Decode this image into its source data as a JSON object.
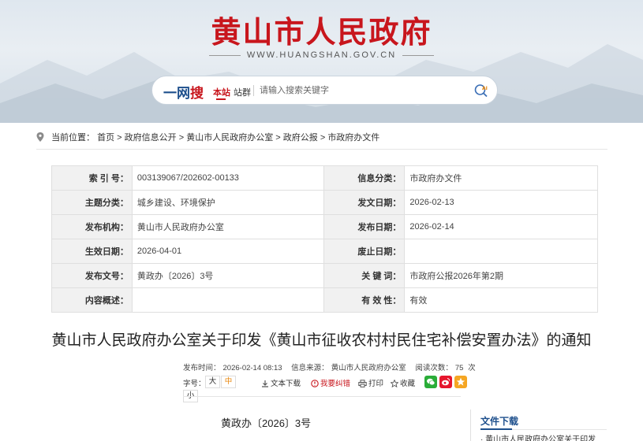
{
  "header": {
    "site_title": "黄山市人民政府",
    "site_url": "WWW.HUANGSHAN.GOV.CN",
    "search": {
      "brand_prefix": "一网",
      "brand_suffix": "搜",
      "scope_site": "本站",
      "scope_group": "站群",
      "placeholder": "请输入搜索关键字"
    }
  },
  "breadcrumb": {
    "prefix": "当前位置：",
    "items": [
      "首页",
      "政府信息公开",
      "黄山市人民政府办公室",
      "政府公报",
      "市政府办文件"
    ],
    "separator": " > "
  },
  "info_table": {
    "rows": [
      {
        "l1": "索 引 号：",
        "v1": "003139067/202602-00133",
        "l2": "信息分类：",
        "v2": "市政府办文件"
      },
      {
        "l1": "主题分类：",
        "v1": "城乡建设、环境保护",
        "l2": "发文日期：",
        "v2": "2026-02-13"
      },
      {
        "l1": "发布机构：",
        "v1": "黄山市人民政府办公室",
        "l2": "发布日期：",
        "v2": "2026-02-14"
      },
      {
        "l1": "生效日期：",
        "v1": "2026-04-01",
        "l2": "废止日期：",
        "v2": ""
      },
      {
        "l1": "发布文号：",
        "v1": "黄政办〔2026〕3号",
        "l2": "关 键 词：",
        "v2": "市政府公报2026年第2期"
      },
      {
        "l1": "内容概述：",
        "v1": "",
        "l2": "有 效 性：",
        "v2": "有效"
      }
    ]
  },
  "article": {
    "title": "黄山市人民政府办公室关于印发《黄山市征收农村村民住宅补偿安置办法》的通知",
    "meta": {
      "publish_time_label": "发布时间：",
      "publish_time": "2026-02-14 08:13",
      "source_label": "信息来源：",
      "source": "黄山市人民政府办公室",
      "views_label": "阅读次数：",
      "views": "75",
      "views_unit": "次"
    },
    "tools": {
      "font_label": "字号：",
      "font_large": "大",
      "font_medium": "中",
      "font_small": "小",
      "download_text": "文本下载",
      "error_report": "我要纠错",
      "print": "打印",
      "favorite": "收藏"
    },
    "doc_number": "黄政办〔2026〕3号"
  },
  "downloads": {
    "title": "文件下载",
    "items": [
      "黄山市人民政府办公室关于印发"
    ]
  },
  "colors": {
    "brand_red": "#c8161d",
    "brand_blue": "#1d4f8c",
    "active_orange": "#e8860c",
    "wechat_green": "#2bad39",
    "weibo_red": "#e6162d",
    "qzone_yellow": "#f5a623"
  },
  "icons": [
    "location-pin-icon",
    "search-ai-icon",
    "download-icon",
    "error-report-icon",
    "print-icon",
    "star-icon",
    "wechat-icon",
    "weibo-icon",
    "qzone-icon"
  ]
}
